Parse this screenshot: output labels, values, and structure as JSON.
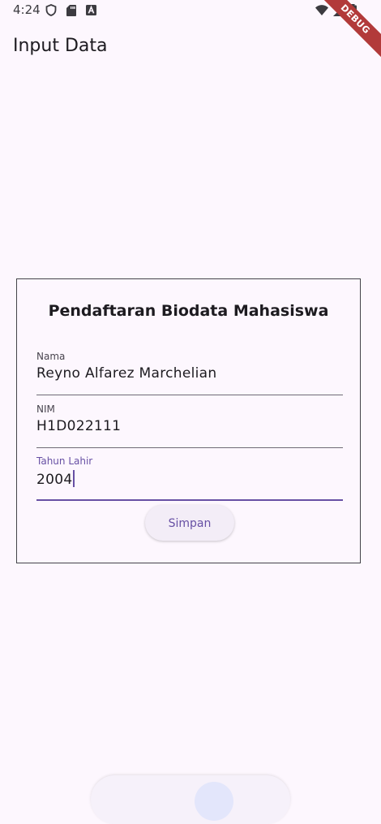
{
  "status_bar": {
    "time": "4:24",
    "icons_left": [
      "shield-icon",
      "sd-card-icon",
      "a-box-icon"
    ],
    "icons_right": [
      "wifi-icon",
      "signal-icon",
      "battery-icon"
    ]
  },
  "debug_banner": "DEBUG",
  "app_bar": {
    "title": "Input Data"
  },
  "form": {
    "title": "Pendaftaran Biodata Mahasiswa",
    "fields": [
      {
        "label": "Nama",
        "value": "Reyno Alfarez Marchelian"
      },
      {
        "label": "NIM",
        "value": "H1D022111"
      },
      {
        "label": "Tahun Lahir",
        "value": "2004"
      }
    ],
    "save_label": "Simpan"
  },
  "colors": {
    "background": "#fdf7fe",
    "accent": "#6750a4",
    "debug": "#b23a3a"
  }
}
